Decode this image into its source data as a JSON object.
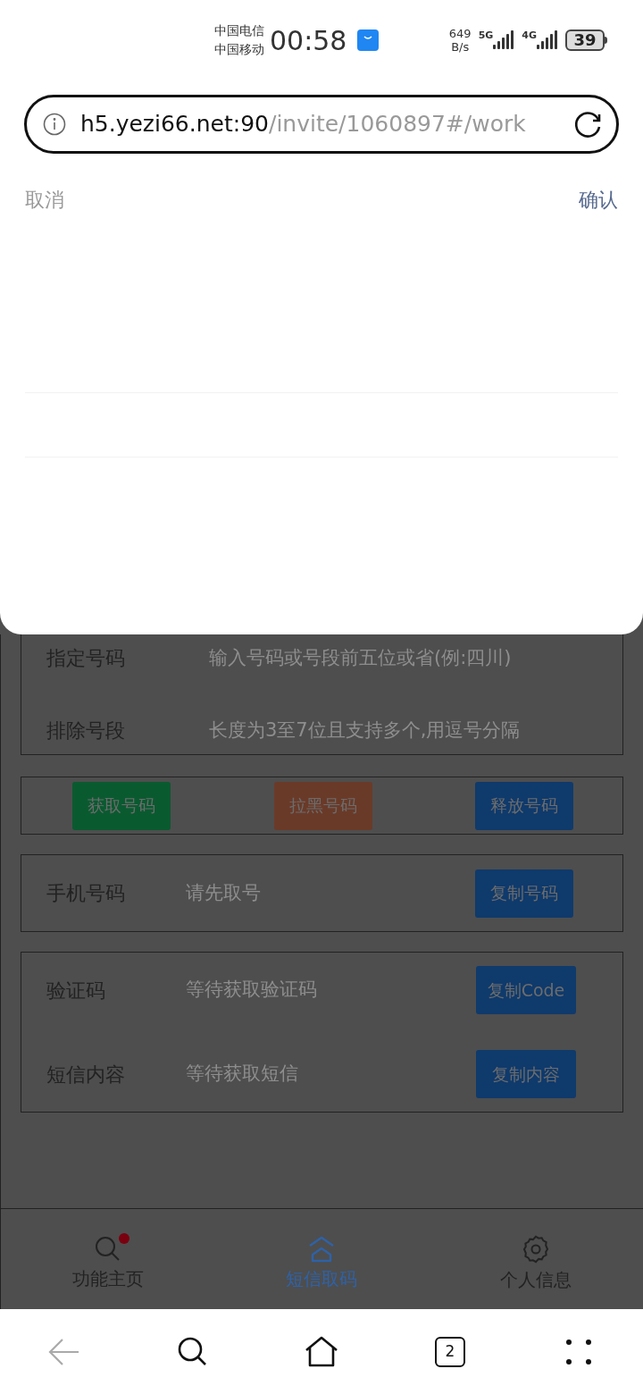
{
  "status_bar": {
    "carriers": [
      "中国电信",
      "中国移动"
    ],
    "time": "00:58",
    "speed": [
      "649",
      "B/s"
    ],
    "network_5g": "5G",
    "network_4g": "4G",
    "battery": "39"
  },
  "address_bar": {
    "host": "h5.yezi66.net:90",
    "path": "/invite/1060897#/work"
  },
  "picker": {
    "cancel": "取消",
    "confirm": "确认"
  },
  "filter_fields": [
    {
      "label": "指定号码",
      "placeholder": "输入号码或号段前五位或省(例:四川)"
    },
    {
      "label": "排除号段",
      "placeholder": "长度为3至7位且支持多个,用逗号分隔"
    }
  ],
  "actions": [
    {
      "label": "获取号码",
      "color": "#0a5a30"
    },
    {
      "label": "拉黑号码",
      "color": "#6a3a28"
    },
    {
      "label": "释放号码",
      "color": "#0f3a6c"
    }
  ],
  "phone": {
    "label": "手机号码",
    "placeholder": "请先取号",
    "button": "复制号码"
  },
  "messages": [
    {
      "label": "验证码",
      "placeholder": "等待获取验证码",
      "button": "复制Code"
    },
    {
      "label": "短信内容",
      "placeholder": "等待获取短信",
      "button": "复制内容"
    }
  ],
  "tabs": [
    {
      "label": "功能主页",
      "kind": "search",
      "selected": false,
      "badge": true
    },
    {
      "label": "短信取码",
      "kind": "home",
      "selected": true,
      "badge": false
    },
    {
      "label": "个人信息",
      "kind": "gear",
      "selected": false,
      "badge": false
    }
  ],
  "browser_nav": {
    "tab_count": "2"
  }
}
